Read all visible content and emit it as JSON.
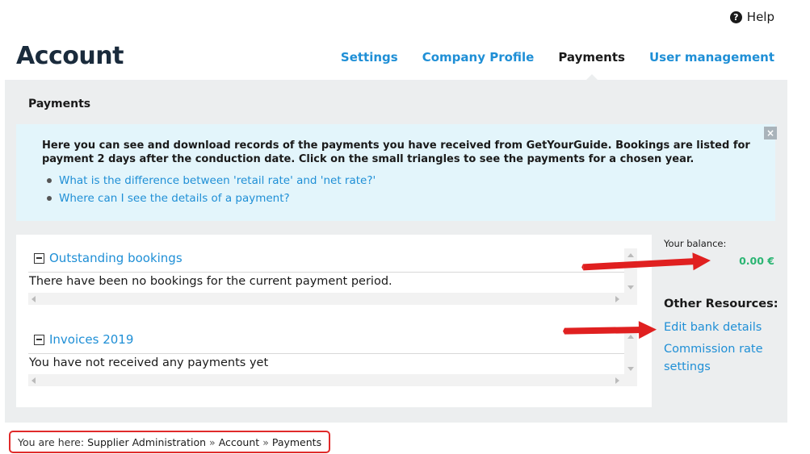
{
  "header": {
    "help_label": "Help",
    "help_icon": "help-icon",
    "page_title": "Account",
    "tabs": [
      {
        "label": "Settings"
      },
      {
        "label": "Company Profile"
      },
      {
        "label": "Payments"
      },
      {
        "label": "User management"
      }
    ],
    "active_tab": "Payments"
  },
  "main": {
    "section_title": "Payments",
    "info": {
      "text": "Here you can see and download records of the payments you have received from GetYourGuide. Bookings are listed for payment 2 days after the conduction date. Click on the small triangles to see the payments for a chosen year.",
      "links": [
        "What is the difference between 'retail rate' and 'net rate?'",
        "Where can I see the details of a payment?"
      ],
      "close_label": "×"
    },
    "sections": [
      {
        "title": "Outstanding bookings",
        "content": "There have been no bookings for the current payment period."
      },
      {
        "title": "Invoices 2019",
        "content": "You have not received any payments yet"
      }
    ]
  },
  "sidebar": {
    "balance_label": "Your balance:",
    "balance_value": "0.00 €",
    "resources_title": "Other Resources:",
    "links": [
      "Edit bank details",
      "Commission rate settings"
    ]
  },
  "breadcrumb": {
    "prefix": "You are here:",
    "items": [
      "Supplier Administration",
      "Account",
      "Payments"
    ],
    "separator": "»"
  },
  "colors": {
    "link": "#1f8fd6",
    "balance": "#2bb573",
    "annotation": "#e02020",
    "info_bg": "#e3f5fb",
    "main_bg": "#eceeef"
  }
}
